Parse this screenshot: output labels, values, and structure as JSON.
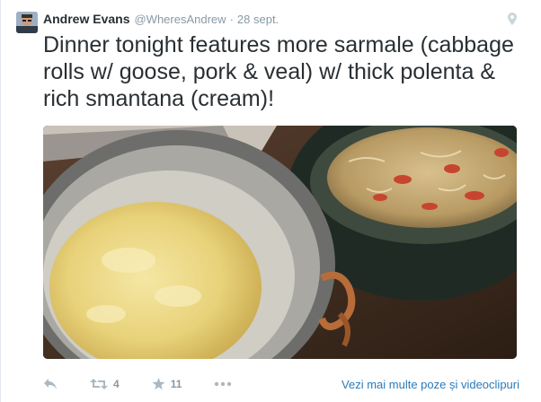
{
  "tweet": {
    "fullname": "Andrew Evans",
    "username": "@WheresAndrew",
    "separator": "·",
    "time": "28 sept.",
    "text": "Dinner tonight features more sarmale (cabbage rolls w/ goose, pork & veal) w/ thick polenta & rich smantana (cream)!",
    "retweet_count": "4",
    "favorite_count": "11",
    "more_media_link": "Vezi mai multe poze și videoclipuri"
  },
  "icons": {
    "geo": "map-pin-icon",
    "reply": "reply-icon",
    "retweet": "retweet-icon",
    "favorite": "star-icon",
    "more": "more-dots-icon"
  },
  "colors": {
    "text": "#292f33",
    "muted": "#8899a6",
    "link": "#2b7bb9",
    "icon": "#aab8c2"
  }
}
